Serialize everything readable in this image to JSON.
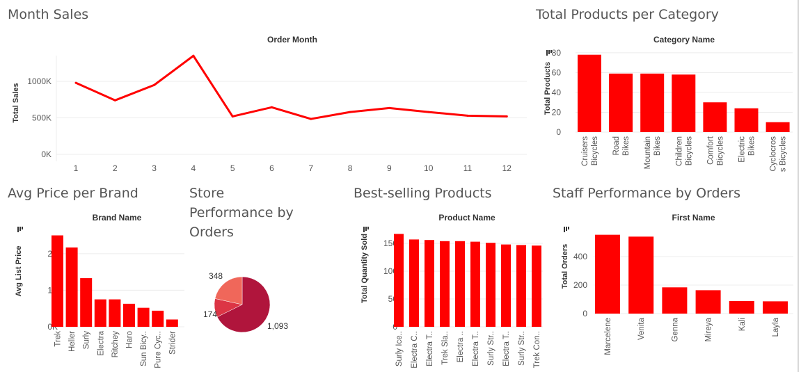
{
  "panels": {
    "month_sales": {
      "title": "Month Sales"
    },
    "products_per_category": {
      "title": "Total Products per Category"
    },
    "avg_price_brand": {
      "title": "Avg Price per Brand"
    },
    "store_performance": {
      "title": "Store Performance by Orders"
    },
    "best_selling": {
      "title": "Best-selling Products"
    },
    "staff_performance": {
      "title": "Staff Performance by Orders"
    }
  },
  "colors": {
    "bar": "#ff0000",
    "line": "#ff0000",
    "grid": "#ececec",
    "text": "#555555",
    "pie": [
      "#b0153c",
      "#dc3545",
      "#f0675a"
    ]
  },
  "chart_data": [
    {
      "id": "month_sales",
      "type": "line",
      "title": "Order Month",
      "xlabel": "",
      "ylabel": "Total Sales",
      "x": [
        "1",
        "2",
        "3",
        "4",
        "5",
        "6",
        "7",
        "8",
        "9",
        "10",
        "11",
        "12"
      ],
      "values": [
        980000,
        740000,
        950000,
        1350000,
        520000,
        645000,
        485000,
        580000,
        635000,
        580000,
        530000,
        520000
      ],
      "yticks": [
        {
          "v": 0,
          "label": "0K"
        },
        {
          "v": 500000,
          "label": "500K"
        },
        {
          "v": 1000000,
          "label": "1000K"
        }
      ],
      "ylim": [
        0,
        1400000
      ],
      "grid": true
    },
    {
      "id": "products_per_category",
      "type": "bar",
      "title": "Category Name",
      "ylabel": "Total Products",
      "categories": [
        "Cruisers Bicycles",
        "Road Bikes",
        "Mountain Bikes",
        "Children Bicycles",
        "Comfort Bicycles",
        "Electric Bikes",
        "Cyclocross Bicycles"
      ],
      "tick_labels": [
        [
          "Cruisers",
          "Bicycles"
        ],
        [
          "Road",
          "Bikes"
        ],
        [
          "Mountain",
          "Bikes"
        ],
        [
          "Children",
          "Bicycles"
        ],
        [
          "Comfort",
          "Bicycles"
        ],
        [
          "Electric",
          "Bikes"
        ],
        [
          "Cyclocros",
          "s Bicycles"
        ]
      ],
      "values": [
        78,
        59,
        59,
        58,
        30,
        24,
        10
      ],
      "yticks": [
        {
          "v": 0,
          "label": "0"
        },
        {
          "v": 20,
          "label": "20"
        },
        {
          "v": 40,
          "label": "40"
        },
        {
          "v": 60,
          "label": "60"
        },
        {
          "v": 80,
          "label": "80"
        }
      ],
      "ylim": [
        0,
        82
      ],
      "grid": true
    },
    {
      "id": "avg_price_brand",
      "type": "bar",
      "title": "Brand Name",
      "ylabel": "Avg List Price",
      "categories": [
        "Trek",
        "Heller",
        "Surly",
        "Electra",
        "Ritchey",
        "Haro",
        "Sun Bicy..",
        "Pure Cyc..",
        "Strider"
      ],
      "values": [
        2500,
        2170,
        1330,
        750,
        750,
        630,
        520,
        440,
        200
      ],
      "yticks": [
        {
          "v": 0,
          "label": "0K"
        },
        {
          "v": 1000,
          "label": "1K"
        },
        {
          "v": 2000,
          "label": "2K"
        }
      ],
      "ylim": [
        0,
        2700
      ],
      "grid": true
    },
    {
      "id": "store_performance",
      "type": "pie",
      "values": [
        1093,
        174,
        348
      ],
      "labels": [
        "1,093",
        "174",
        "348"
      ]
    },
    {
      "id": "best_selling",
      "type": "bar",
      "title": "Product Name",
      "ylabel": "Total Quantity Sold",
      "categories": [
        "Surly Ice..",
        "Electra C..",
        "Electra T..",
        "Trek Sla..",
        "Electra ..",
        "Electra T..",
        "Surly Str..",
        "Electra T..",
        "Surly Str..",
        "Trek Con.."
      ],
      "values": [
        167,
        157,
        156,
        154,
        154,
        153,
        151,
        148,
        147,
        146
      ],
      "yticks": [
        {
          "v": 0,
          "label": "0"
        },
        {
          "v": 50,
          "label": "50"
        },
        {
          "v": 100,
          "label": "100"
        },
        {
          "v": 150,
          "label": "150"
        }
      ],
      "ylim": [
        0,
        175
      ],
      "grid": true
    },
    {
      "id": "staff_performance",
      "type": "bar",
      "title": "First Name",
      "ylabel": "Total Orders",
      "categories": [
        "Marcelene",
        "Venita",
        "Genna",
        "Mireya",
        "Kali",
        "Layla"
      ],
      "values": [
        553,
        540,
        184,
        164,
        88,
        86
      ],
      "yticks": [
        {
          "v": 0,
          "label": "0"
        },
        {
          "v": 200,
          "label": "200"
        },
        {
          "v": 400,
          "label": "400"
        }
      ],
      "ylim": [
        0,
        600
      ],
      "grid": true
    }
  ]
}
